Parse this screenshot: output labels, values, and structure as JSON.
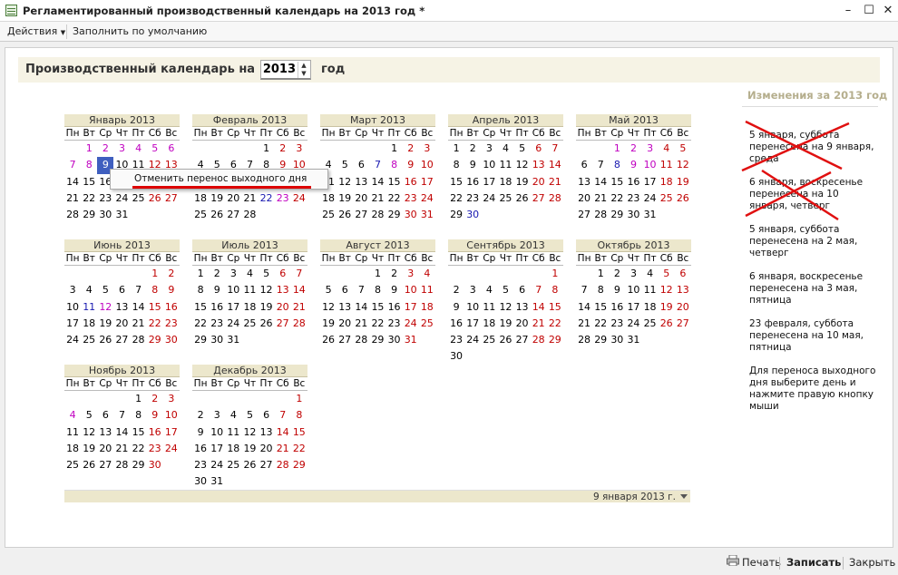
{
  "window": {
    "title": "Регламентированный производственный календарь на 2013 год *"
  },
  "toolbar": {
    "actions_label": "Действия",
    "fill_label": "Заполнить по умолчанию"
  },
  "header": {
    "label": "Производственный календарь на",
    "year": "2013",
    "suffix": "год"
  },
  "weekdays": [
    "Пн",
    "Вт",
    "Ср",
    "Чт",
    "Пт",
    "Сб",
    "Вс"
  ],
  "months": [
    {
      "title": "Январь 2013",
      "offset": 1,
      "days": 31,
      "red": [
        5,
        6,
        12,
        13,
        19,
        20,
        26,
        27
      ],
      "magenta": [
        1,
        2,
        3,
        4,
        5,
        6,
        7,
        8
      ],
      "blue": [],
      "selected": 9
    },
    {
      "title": "Февраль 2013",
      "offset": 4,
      "days": 28,
      "red": [
        2,
        3,
        9,
        10,
        16,
        17,
        24
      ],
      "magenta": [
        23
      ],
      "blue": [
        22
      ],
      "selected": null
    },
    {
      "title": "Март 2013",
      "offset": 4,
      "days": 31,
      "red": [
        2,
        3,
        9,
        10,
        16,
        17,
        23,
        24,
        30,
        31
      ],
      "magenta": [
        8
      ],
      "blue": [
        7
      ],
      "selected": null
    },
    {
      "title": "Апрель 2013",
      "offset": 0,
      "days": 30,
      "red": [
        6,
        7,
        13,
        14,
        20,
        21,
        27,
        28
      ],
      "magenta": [],
      "blue": [
        30
      ],
      "selected": null
    },
    {
      "title": "Май 2013",
      "offset": 2,
      "days": 31,
      "red": [
        4,
        5,
        11,
        12,
        18,
        19,
        25,
        26
      ],
      "magenta": [
        1,
        2,
        3,
        9,
        10
      ],
      "blue": [
        8
      ],
      "selected": null
    },
    {
      "title": "Июнь 2013",
      "offset": 5,
      "days": 30,
      "red": [
        1,
        2,
        8,
        9,
        15,
        16,
        22,
        23,
        29,
        30
      ],
      "magenta": [
        12
      ],
      "blue": [
        11
      ],
      "selected": null
    },
    {
      "title": "Июль 2013",
      "offset": 0,
      "days": 31,
      "red": [
        6,
        7,
        13,
        14,
        20,
        21,
        27,
        28
      ],
      "magenta": [],
      "blue": [],
      "selected": null
    },
    {
      "title": "Август 2013",
      "offset": 3,
      "days": 31,
      "red": [
        3,
        4,
        10,
        11,
        17,
        18,
        24,
        25,
        31
      ],
      "magenta": [],
      "blue": [],
      "selected": null
    },
    {
      "title": "Сентябрь 2013",
      "offset": 6,
      "days": 30,
      "red": [
        1,
        7,
        8,
        14,
        15,
        21,
        22,
        28,
        29
      ],
      "magenta": [],
      "blue": [],
      "selected": null
    },
    {
      "title": "Октябрь 2013",
      "offset": 1,
      "days": 31,
      "red": [
        5,
        6,
        12,
        13,
        19,
        20,
        26,
        27
      ],
      "magenta": [],
      "blue": [],
      "selected": null
    },
    {
      "title": "Ноябрь 2013",
      "offset": 4,
      "days": 30,
      "red": [
        2,
        3,
        9,
        10,
        16,
        17,
        23,
        24,
        30
      ],
      "magenta": [
        4
      ],
      "blue": [],
      "selected": null
    },
    {
      "title": "Декабрь 2013",
      "offset": 6,
      "days": 31,
      "red": [
        1,
        7,
        8,
        14,
        15,
        21,
        22,
        28,
        29
      ],
      "magenta": [],
      "blue": [],
      "selected": null
    }
  ],
  "context_menu": {
    "item": "Отменить перенос выходного дня"
  },
  "date_footer": "9 января 2013 г.",
  "sidebar": {
    "title": "Изменения за 2013 год",
    "notes": [
      "5 января, суббота перенесена на 9 января, среда",
      "6 января, воскресенье перенесена на 10 января, четверг",
      "5 января, суббота перенесена на 2 мая, четверг",
      "6 января, воскресенье перенесена на 3 мая, пятница",
      "23 февраля, суббота перенесена на 10 мая, пятница",
      "Для переноса выходного дня выберите день и нажмите правую кнопку мыши"
    ]
  },
  "bottom": {
    "print_label": "Печать",
    "save_label": "Записать",
    "close_label": "Закрыть"
  },
  "colors": {
    "weekend": "#c00000",
    "transfer": "#c000c0",
    "workday_moved": "#1818b0",
    "selected": "#3f5fbf",
    "month_header": "#ece7cc"
  }
}
